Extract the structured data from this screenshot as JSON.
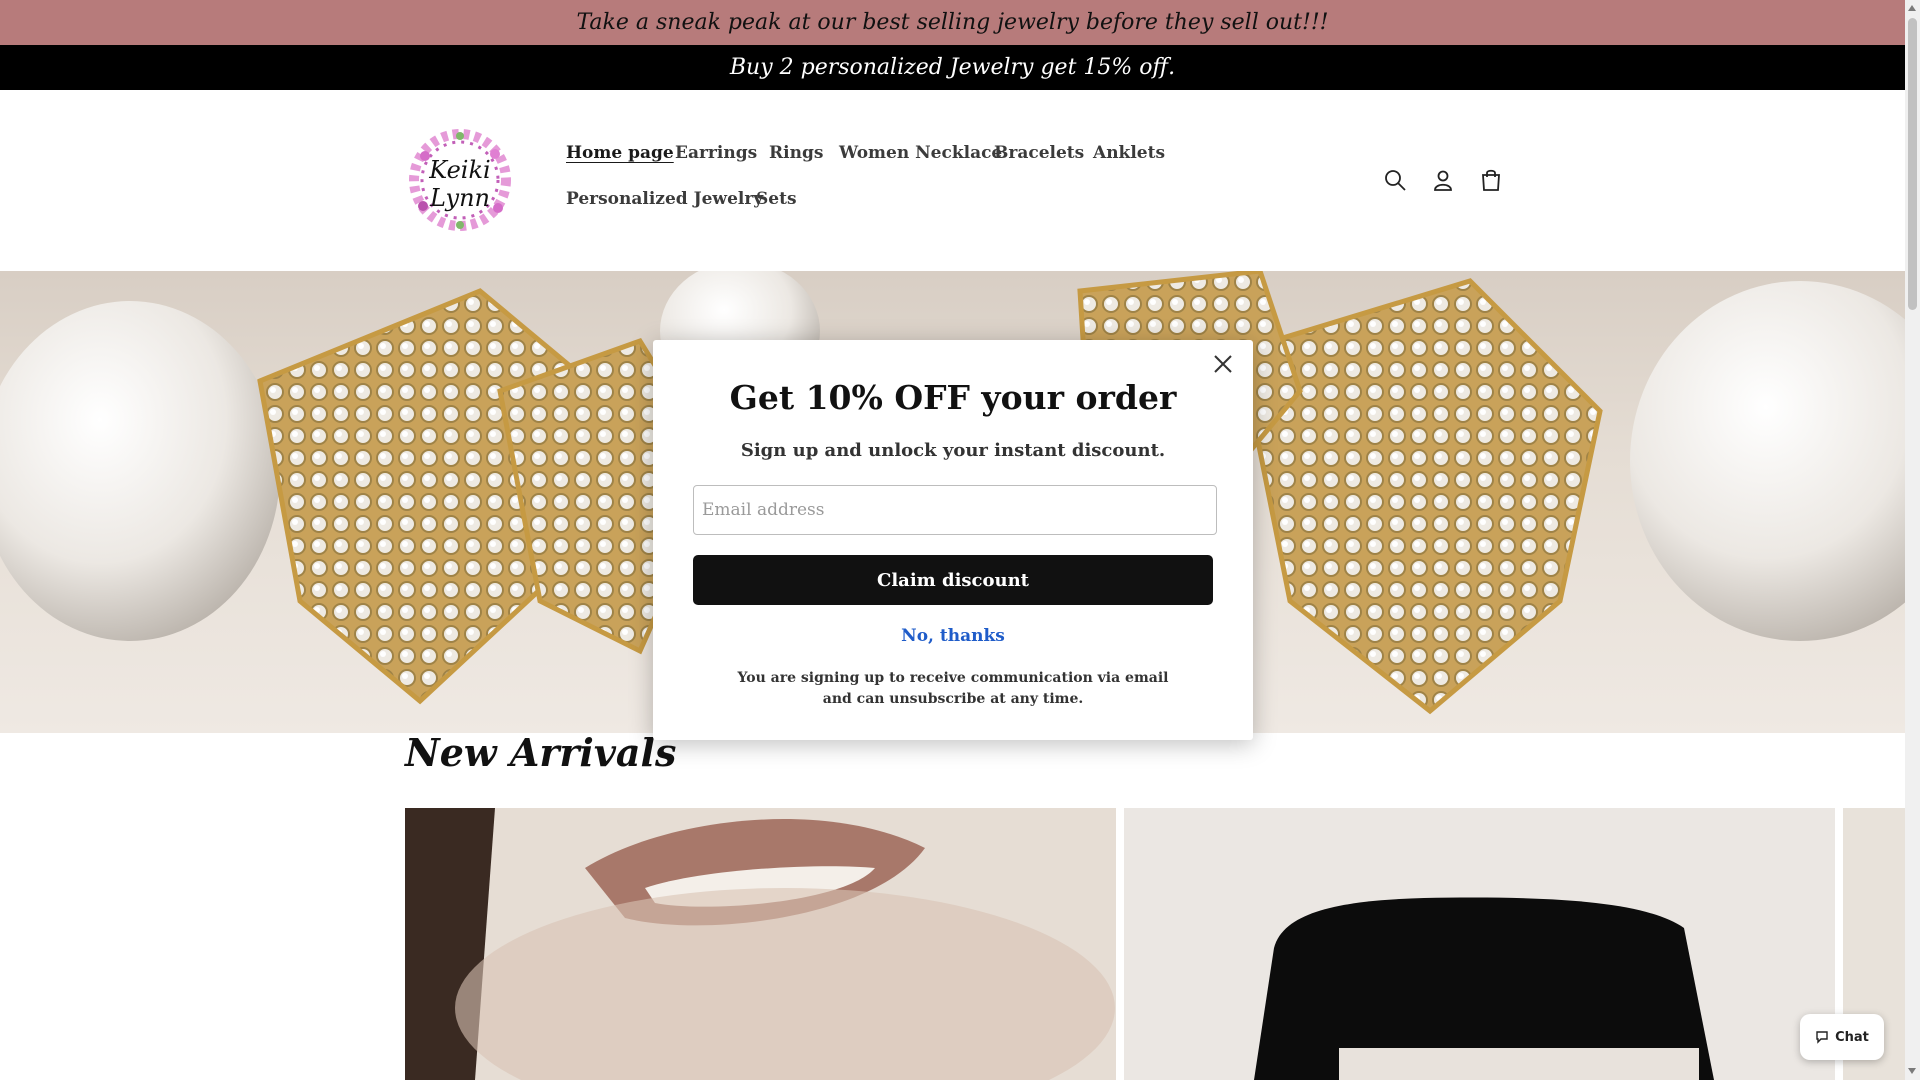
{
  "announcements": {
    "line1": "Take a sneak peak at our best selling jewelry before they sell out!!!",
    "line2": "Buy 2 personalized Jewelry get 15% off."
  },
  "header": {
    "logo_text": "Keiki Lynn",
    "nav": [
      {
        "label": "Home page",
        "active": true
      },
      {
        "label": "Earrings"
      },
      {
        "label": "Rings"
      },
      {
        "label": "Women Necklace"
      },
      {
        "label": "Bracelets"
      },
      {
        "label": "Anklets"
      },
      {
        "label": "Personalized Jewelry"
      },
      {
        "label": "Sets"
      }
    ],
    "icons": [
      "search-icon",
      "account-icon",
      "cart-icon"
    ]
  },
  "section": {
    "title": "New Arrivals"
  },
  "popup": {
    "title": "Get 10% OFF your order",
    "subtitle": "Sign up and unlock your instant discount.",
    "email_placeholder": "Email address",
    "claim_label": "Claim discount",
    "no_thanks": "No, thanks",
    "disclaimer": "You are signing up to receive communication via email and can unsubscribe at any time."
  },
  "chat": {
    "label": "Chat"
  },
  "colors": {
    "announcement_bg": "#b77b7b",
    "announcement2_bg": "#000000",
    "no_thanks_link": "#1f5cc9",
    "claim_button": "#111111"
  }
}
